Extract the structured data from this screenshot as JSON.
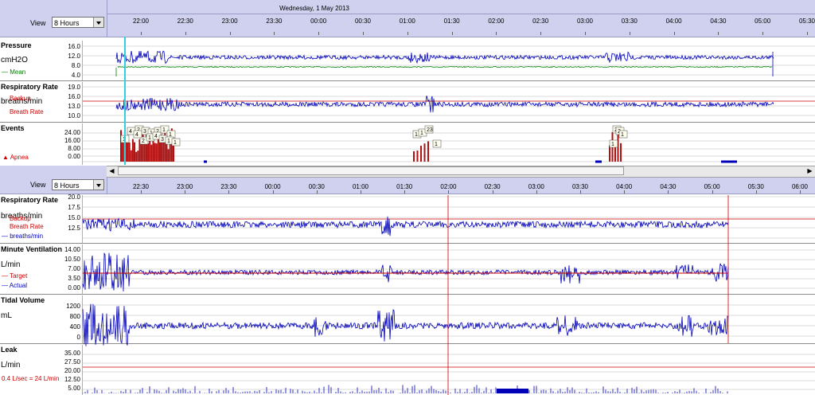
{
  "top": {
    "date": "Wednesday, 1 May 2013",
    "view_label": "View",
    "view_value": "8 Hours",
    "times": [
      "22:00",
      "22:30",
      "23:00",
      "23:30",
      "00:00",
      "00:30",
      "01:00",
      "01:30",
      "02:00",
      "02:30",
      "03:00",
      "03:30",
      "04:00",
      "04:30",
      "05:00",
      "05:30"
    ]
  },
  "panels_top": {
    "pressure": {
      "title": "Pressure",
      "unit": "cmH2O",
      "legend": [
        "Mean"
      ],
      "axis": [
        "16.0",
        "12.0",
        "8.0",
        "4.0"
      ]
    },
    "resp_rate": {
      "title": "Respiratory Rate",
      "unit": "breaths/min",
      "legend": [
        "Backup",
        "Breath Rate"
      ],
      "axis": [
        "19.0",
        "16.0",
        "13.0",
        "10.0"
      ]
    },
    "events": {
      "title": "Events",
      "legend": [
        "Apnea"
      ],
      "axis": [
        "24.00",
        "16.00",
        "8.00",
        "0.00"
      ],
      "flags": [
        "1",
        "4",
        "2",
        "3",
        "1",
        "2",
        "1",
        "1",
        "2",
        "1",
        "4",
        "3",
        "1",
        "1",
        "1",
        "1",
        "23",
        "1",
        "1",
        "2",
        "2",
        "1",
        "4"
      ]
    }
  },
  "bottom": {
    "view_label": "View",
    "view_value": "8 Hours",
    "times": [
      "22:30",
      "23:00",
      "23:30",
      "00:00",
      "00:30",
      "01:00",
      "01:30",
      "02:00",
      "02:30",
      "03:00",
      "03:30",
      "04:00",
      "04:30",
      "05:00",
      "05:30",
      "06:00"
    ]
  },
  "panels_bottom": {
    "resp_rate": {
      "title": "Respiratory Rate",
      "unit": "breaths/min",
      "legend": [
        "Backup",
        "Breath Rate",
        "breaths/min"
      ],
      "axis": [
        "20.0",
        "17.5",
        "15.0",
        "12.5"
      ]
    },
    "minute_vent": {
      "title": "Minute Ventilation",
      "unit": "L/min",
      "legend": [
        "Target",
        "Actual"
      ],
      "axis": [
        "14.00",
        "10.50",
        "7.00",
        "3.50",
        "0.00"
      ]
    },
    "tidal_volume": {
      "title": "Tidal Volume",
      "unit": "mL",
      "axis": [
        "1200",
        "800",
        "400",
        "0"
      ]
    },
    "leak": {
      "title": "Leak",
      "unit": "L/min",
      "note": "0.4 L/sec = 24 L/min",
      "axis": [
        "35.00",
        "27.50",
        "20.00",
        "12.50",
        "5.00"
      ]
    }
  },
  "colors": {
    "header": "#cfd1ee",
    "trace": "#0000b8",
    "mean": "#008000",
    "threshold": "#cc0000",
    "event": "#b01010",
    "cursor": "#30d0e0"
  }
}
